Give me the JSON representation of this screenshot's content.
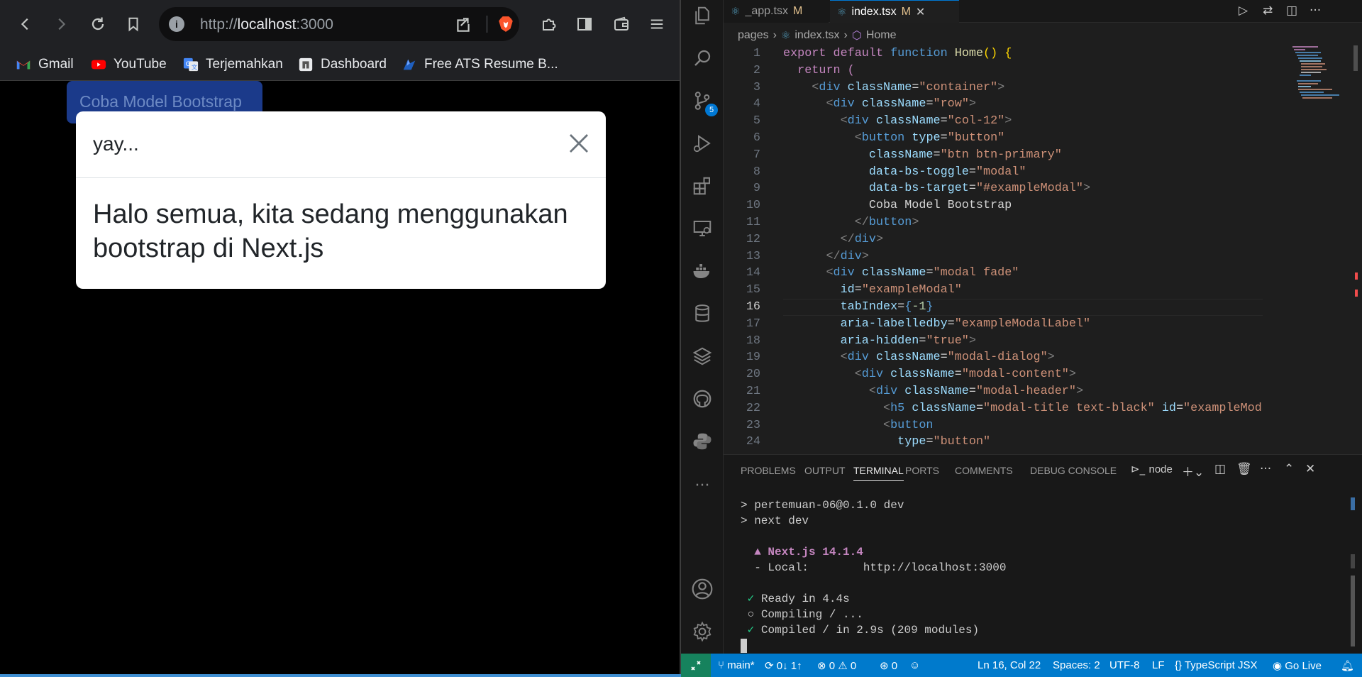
{
  "browser": {
    "url_scheme": "http://",
    "url_host": "localhost",
    "url_port": ":3000",
    "bookmarks": [
      {
        "label": "Gmail",
        "icon": "gmail-icon"
      },
      {
        "label": "YouTube",
        "icon": "youtube-icon"
      },
      {
        "label": "Terjemahkan",
        "icon": "google-translate-icon"
      },
      {
        "label": "Dashboard",
        "icon": "dashboard-icon"
      },
      {
        "label": "Free ATS Resume B...",
        "icon": "resume-icon"
      }
    ],
    "page": {
      "button_label": "Coba Model Bootstrap",
      "modal_title": "yay...",
      "modal_body": "Halo semua, kita sedang menggunakan bootstrap di Next.js"
    }
  },
  "vscode": {
    "tabs": [
      {
        "label": "_app.tsx",
        "status": "M"
      },
      {
        "label": "index.tsx",
        "status": "M"
      }
    ],
    "breadcrumb": [
      "pages",
      "index.tsx",
      "Home"
    ],
    "scm_badge": "5",
    "current_line": "16",
    "code_lines": [
      "1",
      "2",
      "3",
      "4",
      "5",
      "6",
      "7",
      "8",
      "9",
      "10",
      "11",
      "12",
      "13",
      "14",
      "15",
      "16",
      "17",
      "18",
      "19",
      "20",
      "21",
      "22",
      "23",
      "24"
    ],
    "panel_tabs": [
      "PROBLEMS",
      "OUTPUT",
      "TERMINAL",
      "PORTS",
      "COMMENTS",
      "DEBUG CONSOLE"
    ],
    "terminal_shell": "node",
    "terminal": {
      "line1": "> pertemuan-06@0.1.0 dev",
      "line2": "> next dev",
      "next_version": "▲ Next.js 14.1.4",
      "local_label": "- Local:",
      "local_url": "http://localhost:3000",
      "ready": "Ready in 4.4s",
      "compiling": "Compiling / ...",
      "compiled": "Compiled / in 2.9s (209 modules)"
    },
    "status": {
      "branch": "main*",
      "sync": "0↓ 1↑",
      "errors": "0",
      "warnings": "0",
      "ports": "0",
      "cursor": "Ln 16, Col 22",
      "spaces": "Spaces: 2",
      "encoding": "UTF-8",
      "eol": "LF",
      "language": "TypeScript JSX",
      "golive": "Go Live"
    }
  }
}
